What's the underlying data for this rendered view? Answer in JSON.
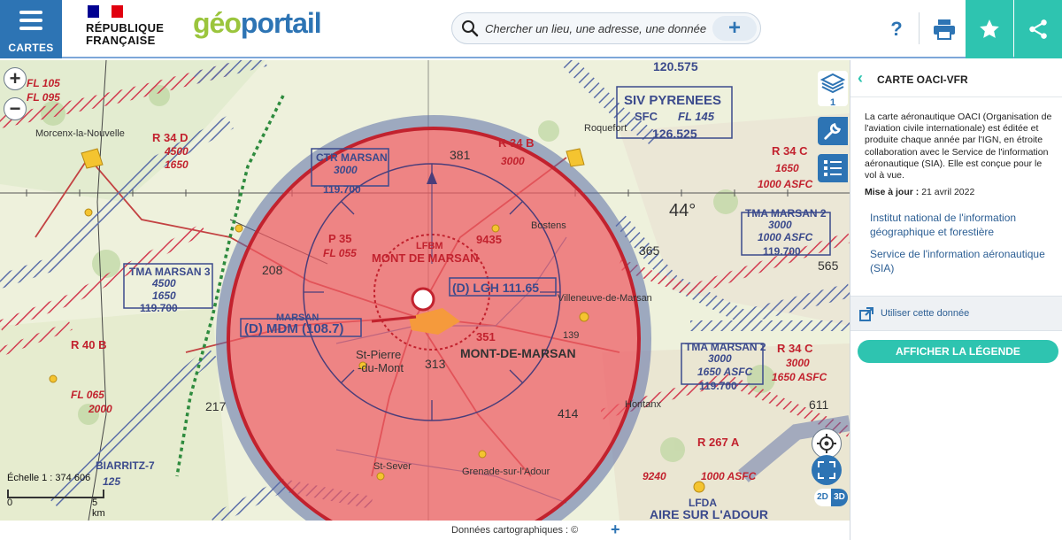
{
  "header": {
    "menu_label": "CARTES",
    "republique_line1": "RÉPUBLIQUE",
    "republique_line2": "FRANÇAISE",
    "logo_part1": "géo",
    "logo_part2": "portail",
    "search_placeholder": "Chercher un lieu, une adresse, une donnée",
    "search_plus": "+",
    "help_label": "?",
    "colors": {
      "brand_blue": "#2d74b4",
      "accent_teal": "#2ec4b0",
      "logo_green": "#9bc53d"
    }
  },
  "map": {
    "zoom_in": "+",
    "zoom_out": "−",
    "scale_label": "Échelle 1 : 374 606",
    "scale_km": "5 km",
    "scale_zero": "0",
    "layers_count": "1",
    "mode_2d": "2D",
    "mode_3d": "3D",
    "labels": {
      "fl105": "FL 105",
      "fl095": "FL 095",
      "freq_120575": "120.575",
      "siv": "SIV PYRENEES",
      "sfc": "SFC",
      "fl145": "FL 145",
      "freq_126525": "126.525",
      "r34d": "R 34 D",
      "r34d_1": "4500",
      "r34d_2": "1650",
      "ctr_marsan": "CTR MARSAN",
      "ctr_3000": "3000",
      "freq_119700": "119.700",
      "r34b": "R 34 B",
      "r34b_3000": "3000",
      "r34c_top": "R 34 C",
      "r34c_1650": "1650",
      "asfc_1000": "1000 ASFC",
      "tma_marsan2": "TMA MARSAN 2",
      "tma2_3000": "3000",
      "tma2_1000asfc": "1000 ASFC",
      "tma2_freq": "119.700",
      "lat44": "44°",
      "p35": "P 35",
      "fl055": "FL 055",
      "lfbm": "LFBM",
      "mont_de_marsan": "MONT DE MARSAN",
      "lgh": "(D) LGH 111.65",
      "mdm": "(D) MDM (108.7)",
      "marsan": "MARSAN",
      "mont_de_marsan_town": "MONT-DE-MARSAN",
      "st_pierre": "St-Pierre",
      "du_mont": "-du-Mont",
      "tma_marsan3": "TMA MARSAN 3",
      "tma3_4500": "4500",
      "tma3_1650": "1650",
      "tma3_freq": "119.700",
      "tma_marsan2b": "TMA MARSAN 2",
      "tma2b_3000": "3000",
      "tma2b_1650asfc": "1650 ASFC",
      "tma2b_freq": "119.700",
      "r34c_low": "R 34 C",
      "r34c_low_3000": "3000",
      "r34c_low_asfc": "1650 ASFC",
      "r40b": "R 40 B",
      "fl065": "FL 065",
      "r40b_2000": "2000",
      "r267a": "R 267 A",
      "r267_1000": "1000 ASFC",
      "r267_9240": "9240",
      "lfda": "LFDA",
      "aire": "AIRE SUR L'ADOUR",
      "biarritz": "BIARRITZ-7",
      "b_125": "125",
      "morcenx": "Morcenx-la-Nouvelle",
      "roquefort": "Roquefort",
      "bostens": "Bostens",
      "villeneuve": "Villeneuve-de-Marsan",
      "st_sever": "St-Sever",
      "grenade": "Grenade-sur-l'Adour",
      "hontanx": "Hontanx",
      "n381": "381",
      "n9435": "9435",
      "n351": "351",
      "n313": "313",
      "n414": "414",
      "n365": "365",
      "n208": "208",
      "n217": "217",
      "n565": "565",
      "n611": "611",
      "n139": "139"
    }
  },
  "footer": {
    "credits": "Données cartographiques : ©",
    "plus": "+"
  },
  "panel": {
    "title": "CARTE OACI-VFR",
    "description": "La carte aéronautique OACI (Organisation de l'aviation civile internationale) est éditée et produite chaque année par l'IGN, en étroite collaboration avec le Service de l'information aéronautique (SIA). Elle est conçue pour le vol à vue.",
    "update_label": "Mise à jour :",
    "update_value": "21 avril 2022",
    "link_ign": "Institut national de l'information géographique et forestière",
    "link_sia": "Service de l'information aéronautique (SIA)",
    "use_data": "Utiliser cette donnée",
    "legend_button": "AFFICHER LA LÉGENDE"
  }
}
